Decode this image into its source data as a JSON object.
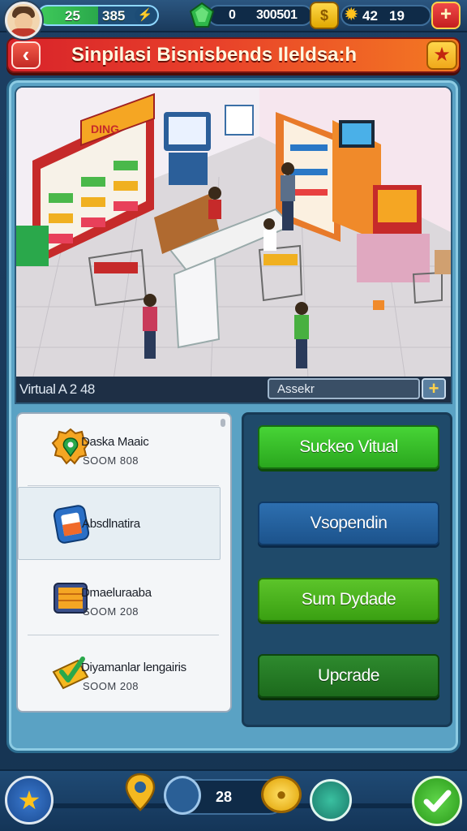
{
  "topbar": {
    "xp_value_a": "25",
    "xp_value_b": "385",
    "cash_value_a": "0",
    "cash_value_b": "300501",
    "resource_value_a": "42",
    "resource_value_b": "19",
    "plus_label": "+"
  },
  "header": {
    "title": "Sinpilasi Bisnisbends Ileldsa:h"
  },
  "scene": {
    "sign_text": "DING"
  },
  "infobar": {
    "label": "Virtual A 2  48",
    "search_value": "Assekr",
    "add_label": "+"
  },
  "list": {
    "items": [
      {
        "name": "Daska Maaic",
        "sub": "SOOM 808",
        "icon": "map-pin-badge-icon"
      },
      {
        "name": "Absdlnatira",
        "sub": "",
        "icon": "juice-card-icon"
      },
      {
        "name": "Dmaeluraaba",
        "sub": "SOOM 208",
        "icon": "crate-icon"
      },
      {
        "name": "Diyamanlar lengairis",
        "sub": "SOOM 208",
        "icon": "checkmark-ticket-icon"
      }
    ]
  },
  "actions": {
    "btn1": "Suckeo Vitual",
    "btn2": "Vsopendin",
    "btn3": "Sum Dydade",
    "btn4": "Upcrade"
  },
  "bottombar": {
    "cart_count": "28"
  },
  "colors": {
    "title_red": "#d8232a",
    "title_orange": "#f47a22",
    "primary_green": "#2aa71e",
    "primary_blue": "#1c538c",
    "panel_blue": "#5aa2c4"
  }
}
